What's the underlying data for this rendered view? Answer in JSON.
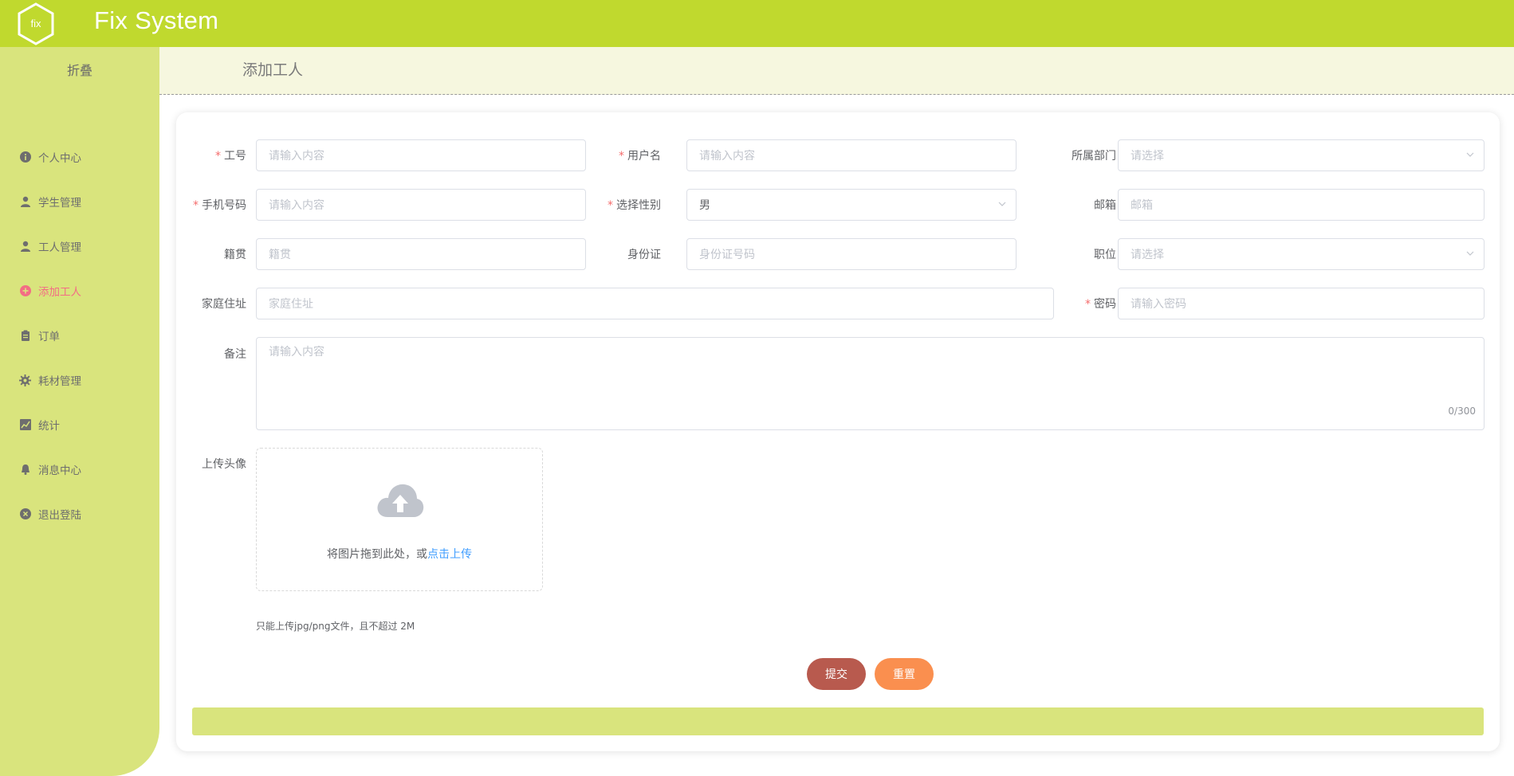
{
  "app": {
    "title": "Fix System",
    "logo_text": "fix"
  },
  "sidebar": {
    "collapse_label": "折叠",
    "items": [
      {
        "label": "个人中心",
        "icon": "info-icon"
      },
      {
        "label": "学生管理",
        "icon": "user-icon"
      },
      {
        "label": "工人管理",
        "icon": "user-icon"
      },
      {
        "label": "添加工人",
        "icon": "plus-circle-icon",
        "active": true
      },
      {
        "label": "订单",
        "icon": "clipboard-icon"
      },
      {
        "label": "耗材管理",
        "icon": "gear-icon"
      },
      {
        "label": "统计",
        "icon": "chart-icon"
      },
      {
        "label": "消息中心",
        "icon": "bell-icon"
      },
      {
        "label": "退出登陆",
        "icon": "close-circle-icon"
      }
    ]
  },
  "page": {
    "title": "添加工人"
  },
  "form": {
    "employee_id": {
      "label": "工号",
      "required": true,
      "placeholder": "请输入内容"
    },
    "username": {
      "label": "用户名",
      "required": true,
      "placeholder": "请输入内容"
    },
    "department": {
      "label": "所属部门",
      "placeholder": "请选择"
    },
    "phone": {
      "label": "手机号码",
      "required": true,
      "placeholder": "请输入内容"
    },
    "gender": {
      "label": "选择性别",
      "required": true,
      "value": "男"
    },
    "email": {
      "label": "邮箱",
      "placeholder": "邮箱"
    },
    "hometown": {
      "label": "籍贯",
      "placeholder": "籍贯"
    },
    "id_card": {
      "label": "身份证",
      "placeholder": "身份证号码"
    },
    "position": {
      "label": "职位",
      "placeholder": "请选择"
    },
    "address": {
      "label": "家庭住址",
      "placeholder": "家庭住址"
    },
    "password": {
      "label": "密码",
      "required": true,
      "placeholder": "请输入密码"
    },
    "remarks": {
      "label": "备注",
      "placeholder": "请输入内容",
      "counter": "0/300"
    },
    "avatar": {
      "label": "上传头像",
      "drop_text": "将图片拖到此处，或",
      "click_text": "点击上传",
      "tip": "只能上传jpg/png文件，且不超过 2M"
    },
    "submit_label": "提交",
    "reset_label": "重置"
  },
  "colors": {
    "header": "#c0d92e",
    "sidebar": "#d9e47d",
    "active": "#f36d85",
    "submit": "#b85a4e",
    "reset": "#fa8f4f"
  }
}
